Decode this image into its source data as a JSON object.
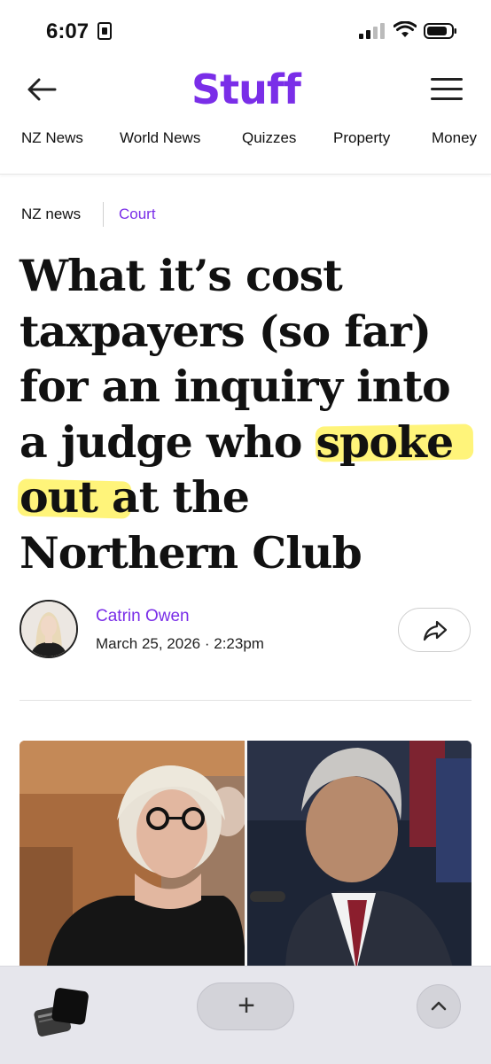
{
  "status_bar": {
    "time": "6:07"
  },
  "header": {
    "logo_text": "Stuff",
    "brand_color": "#7a2ee8",
    "nav_items": [
      "NZ News",
      "World News",
      "Quizzes",
      "Property",
      "Money"
    ]
  },
  "breadcrumbs": {
    "section": "NZ news",
    "topic": "Court"
  },
  "article": {
    "headline": "What it’s cost taxpayers (so far) for an inquiry into a judge who spoke out at the Northern Club",
    "highlighted_phrase": "spoke out",
    "highlight_color": "#fff36b",
    "author": "Catrin Owen",
    "published": "March 25, 2026 · 2:23pm"
  },
  "bottom_bar": {
    "add_label": "+"
  }
}
